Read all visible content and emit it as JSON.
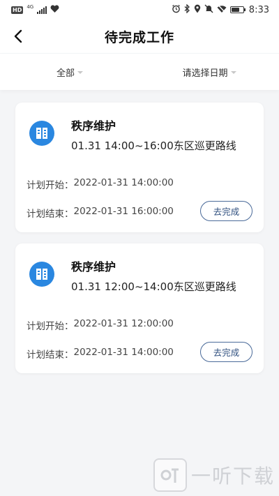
{
  "status_bar": {
    "hd_label": "HD",
    "network_label": "4G",
    "time": "8:33",
    "icons": [
      "alarm-icon",
      "bluetooth-icon",
      "location-icon",
      "mute-icon",
      "wifi-off-icon",
      "battery-icon"
    ]
  },
  "header": {
    "title": "待完成工作",
    "back_icon": "chevron-left-icon"
  },
  "filters": {
    "all_label": "全部",
    "date_label": "请选择日期"
  },
  "tasks": [
    {
      "title": "秩序维护",
      "subtitle": "01.31 14:00~16:00东区巡更路线",
      "start_label": "计划开始：",
      "start_value": "2022-01-31 14:00:00",
      "end_label": "计划结束：",
      "end_value": "2022-01-31 16:00:00",
      "button_label": "去完成"
    },
    {
      "title": "秩序维护",
      "subtitle": "01.31 12:00~14:00东区巡更路线",
      "start_label": "计划开始：",
      "start_value": "2022-01-31 12:00:00",
      "end_label": "计划结束：",
      "end_value": "2022-01-31 14:00:00",
      "button_label": "去完成"
    }
  ],
  "watermark": {
    "text": "一听下载"
  },
  "colors": {
    "accent_blue": "#2a87e0",
    "button_border": "#4a6a99",
    "background": "#f4f5f7"
  }
}
